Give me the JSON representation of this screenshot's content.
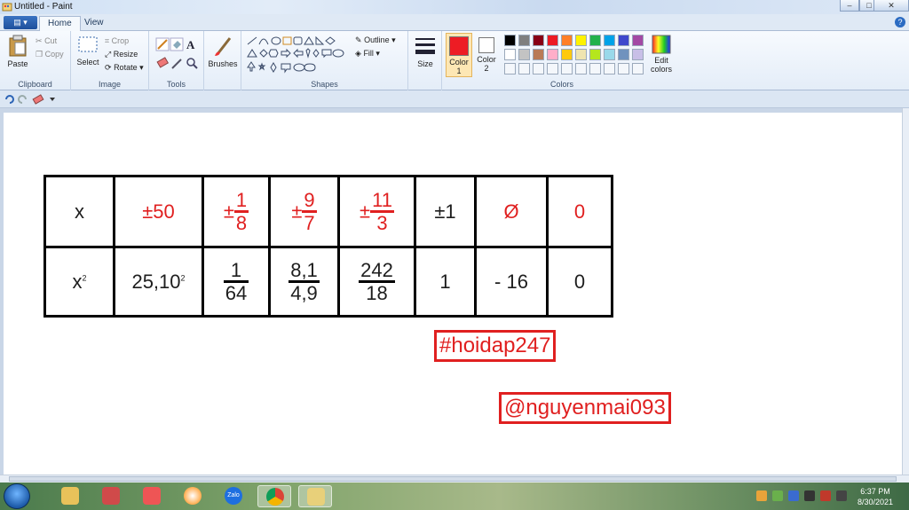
{
  "window": {
    "title": "Untitled - Paint",
    "controls": {
      "minimize": "–",
      "maximize": "□",
      "close": "✕"
    }
  },
  "ribbon_tabs": {
    "file": "▤ ▾",
    "home": "Home",
    "view": "View",
    "help": "?"
  },
  "clipboard": {
    "paste": "Paste",
    "cut": "Cut",
    "copy": "Copy",
    "label": "Clipboard"
  },
  "image": {
    "select": "Select",
    "crop": "Crop",
    "resize": "Resize",
    "rotate": "Rotate ▾",
    "label": "Image"
  },
  "tools": {
    "label": "Tools"
  },
  "brushes": {
    "label": "Brushes"
  },
  "shapes": {
    "outline": "Outline ▾",
    "fill": "Fill ▾",
    "label": "Shapes"
  },
  "size": {
    "label": "Size"
  },
  "colors": {
    "color1": "Color",
    "color1_num": "1",
    "color2": "Color",
    "color2_num": "2",
    "edit_line1": "Edit",
    "edit_line2": "colors",
    "label": "Colors",
    "color1_value": "#ed1c24",
    "color2_value": "#ffffff",
    "palette_row1": [
      "#000000",
      "#7f7f7f",
      "#880015",
      "#ed1c24",
      "#ff7f27",
      "#fff200",
      "#22b14c",
      "#00a2e8",
      "#3f48cc",
      "#a349a4"
    ],
    "palette_row2": [
      "#ffffff",
      "#c3c3c3",
      "#b97a57",
      "#ffaec9",
      "#ffc90e",
      "#efe4b0",
      "#b5e61d",
      "#99d9ea",
      "#7092be",
      "#c8bfe7"
    ]
  },
  "drawing": {
    "row1": {
      "x": "x",
      "c1": "±50",
      "c2": {
        "sign": "±",
        "num": "1",
        "den": "8"
      },
      "c3": {
        "sign": "±",
        "num": "9",
        "den": "7"
      },
      "c4": {
        "sign": "±",
        "num": "11",
        "den": "3"
      },
      "c5": "±1",
      "c6": "Ø",
      "c7": "0"
    },
    "row2": {
      "x": "x",
      "x_exp": "2",
      "c1": "25,10",
      "c1_exp": "2",
      "c2": {
        "num": "1",
        "den": "64"
      },
      "c3": {
        "num": "8,1",
        "den": "4,9"
      },
      "c4": {
        "num": "242",
        "den": "18"
      },
      "c5": "1",
      "c6": "- 16",
      "c7": "0"
    },
    "tag1": "#hoidap247",
    "tag2": "@nguyenmai093"
  },
  "taskbar": {
    "time": "6:37 PM",
    "date": "8/30/2021",
    "zalo": "Zalo"
  }
}
